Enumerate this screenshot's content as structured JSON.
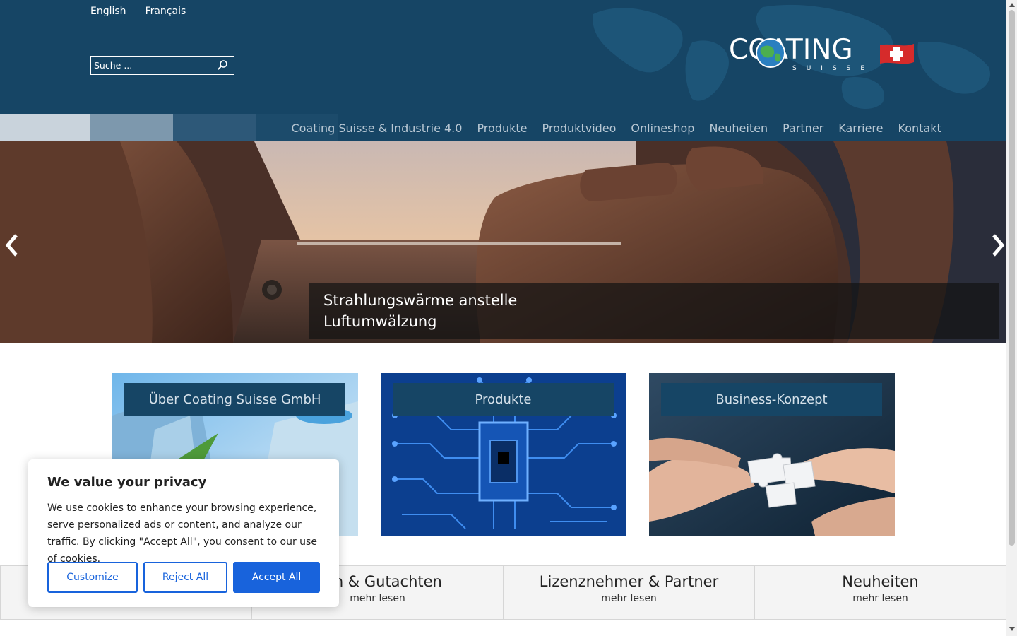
{
  "header": {
    "languages": [
      "English",
      "Français"
    ],
    "search": {
      "placeholder": "Suche ..."
    },
    "logo": {
      "word": "COATING",
      "sub": "SUISSE"
    }
  },
  "nav": {
    "items": [
      "Coating Suisse & Industrie 4.0",
      "Produkte",
      "Produktvideo",
      "Onlineshop",
      "Neuheiten",
      "Partner",
      "Karriere",
      "Kontakt"
    ]
  },
  "slider": {
    "caption_line1": "Strahlungswärme anstelle",
    "caption_line2": "Luftumwälzung"
  },
  "tiles": [
    "Über Coating Suisse GmbH",
    "Produkte",
    "Business-Konzept"
  ],
  "boxes": [
    {
      "title": "",
      "link": ""
    },
    {
      "title": "isen & Gutachten",
      "link": "mehr lesen"
    },
    {
      "title": "Lizenznehmer & Partner",
      "link": "mehr lesen"
    },
    {
      "title": "Neuheiten",
      "link": "mehr lesen"
    }
  ],
  "cookie": {
    "title": "We value your privacy",
    "text": "We use cookies to enhance your browsing experience, serve personalized ads or content, and analyze our traffic. By clicking \"Accept All\", you consent to our use of cookies.",
    "customize": "Customize",
    "reject": "Reject All",
    "accept": "Accept All"
  },
  "colors": {
    "header_bg": "#164565",
    "accent": "#1863dc",
    "tile_label_bg": "#164565"
  },
  "icons": [
    "search-icon",
    "chevron-left-icon",
    "chevron-right-icon",
    "globe-icon",
    "swiss-flag-icon"
  ]
}
